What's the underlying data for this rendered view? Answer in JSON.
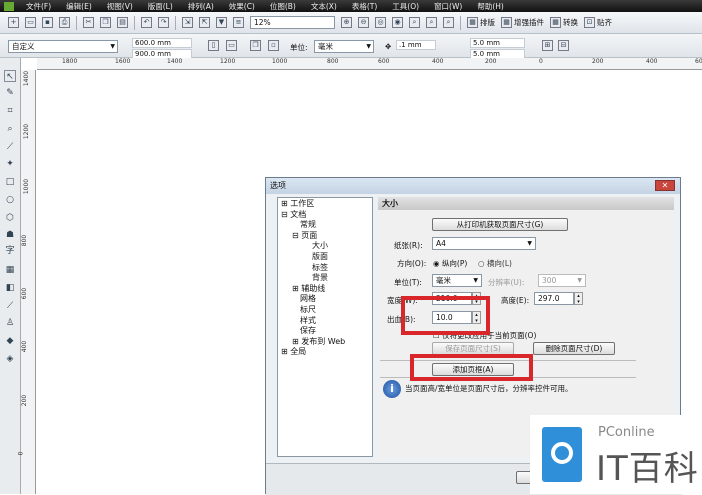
{
  "menu": [
    "文件(F)",
    "编辑(E)",
    "视图(V)",
    "版面(L)",
    "排列(A)",
    "效果(C)",
    "位图(B)",
    "文本(X)",
    "表格(T)",
    "工具(O)",
    "窗口(W)",
    "帮助(H)"
  ],
  "toolbar": {
    "zoom": "12%",
    "arrange": "排版",
    "plugin": "增强插件",
    "convert": "转换",
    "snap": "贴齐"
  },
  "propbar": {
    "preset": "自定义",
    "width": "600.0 mm",
    "height": "900.0 mm",
    "unit_label": "单位:",
    "unit": "毫米",
    "nudge": ".1 mm",
    "dup_x": "5.0 mm",
    "dup_y": "5.0 mm"
  },
  "hruler": [
    "1800",
    "1600",
    "1400",
    "1200",
    "1000",
    "800",
    "600",
    "400",
    "200",
    "0",
    "200",
    "400",
    "600"
  ],
  "vruler": [
    "1400",
    "1200",
    "1000",
    "800",
    "600",
    "400",
    "200",
    "0"
  ],
  "dialog": {
    "title": "选项",
    "tree": [
      "工作区",
      "文档",
      "常规",
      "页面",
      "大小",
      "版面",
      "标签",
      "背景",
      "辅助线",
      "网格",
      "标尺",
      "样式",
      "保存",
      "发布到 Web",
      "全局"
    ],
    "section": "大小",
    "get_from_printer": "从打印机获取页面尺寸(G)",
    "paper_label": "纸张(R):",
    "paper": "A4",
    "orientation_label": "方向(O):",
    "portrait": "纵向(P)",
    "landscape": "横向(L)",
    "unit_label": "单位(T):",
    "unit": "毫米",
    "resolution_label": "分辨率(U):",
    "resolution": "300",
    "width_label": "宽度(W):",
    "width": "210.0",
    "height_label": "高度(E):",
    "height": "297.0",
    "bleed_label": "出血(B):",
    "bleed": "10.0",
    "apply_current": "仅将更改应用于当前页面(O)",
    "save_size": "保存页面尺寸(S)",
    "delete_size": "删除页面尺寸(D)",
    "add_frame": "添加页框(A)",
    "info": "当页面高/宽单位是页面尺寸后，分辨率控件可用。"
  },
  "watermark": {
    "brand": "PConline",
    "name": "IT百科"
  }
}
